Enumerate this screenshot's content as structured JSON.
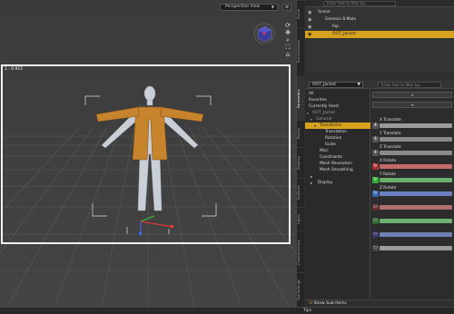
{
  "viewport": {
    "view_dropdown": "Perspective View",
    "camera_label": "1 : 0.915",
    "menu_icon": "menu-icon",
    "nav_icons": [
      "rotate-icon",
      "pan-icon",
      "zoom-icon",
      "frame-icon",
      "home-icon"
    ]
  },
  "tabs": [
    "Scene",
    "Environments",
    "Parameters",
    "Posing",
    "Shaping",
    "Surfaces",
    "Lights",
    "Content Library",
    "Tool Settings",
    "Aux Viewport"
  ],
  "scene": {
    "search_placeholder": "Enter text to filter by...",
    "rows": [
      {
        "label": "Scene"
      },
      {
        "label": "Genesis 8 Male"
      },
      {
        "label": "hip"
      },
      {
        "label": "OOT_Jacket"
      }
    ]
  },
  "parameters": {
    "selector": "OOT_Jacket",
    "search_placeholder": "Enter text to filter by...",
    "tree": [
      {
        "label": "All"
      },
      {
        "label": "Favorites"
      },
      {
        "label": "Currently Used"
      },
      {
        "label": "OOT_Jacket"
      },
      {
        "label": "General"
      },
      {
        "label": "Transforms"
      },
      {
        "label": "Translation"
      },
      {
        "label": "Rotation"
      },
      {
        "label": "Scale"
      },
      {
        "label": "Misc"
      },
      {
        "label": "Constraints"
      },
      {
        "label": "Mesh Resolution"
      },
      {
        "label": "Mesh Smoothing"
      },
      {
        "label": "Display"
      }
    ],
    "sliders": [
      {
        "label": "X Translate",
        "color": "#9a9a9a"
      },
      {
        "label": "Y Translate",
        "color": "#8a8a8a"
      },
      {
        "label": "Z Translate",
        "color": "#8a8a8a"
      },
      {
        "label": "X Rotate",
        "color": "#c06a6a"
      },
      {
        "label": "Y Rotate",
        "color": "#6ab06a"
      },
      {
        "label": "Z Rotate",
        "color": "#6a82c0"
      },
      {
        "label": "",
        "color": "#b07070"
      },
      {
        "label": "",
        "color": "#70b070"
      },
      {
        "label": "",
        "color": "#7080b0"
      },
      {
        "label": "",
        "color": "#9a9a9a"
      }
    ],
    "footer_toggle": "Show Sub-Items"
  },
  "bottom": {
    "tips_label": "Tips"
  },
  "colors": {
    "accent": "#d7a21d"
  }
}
